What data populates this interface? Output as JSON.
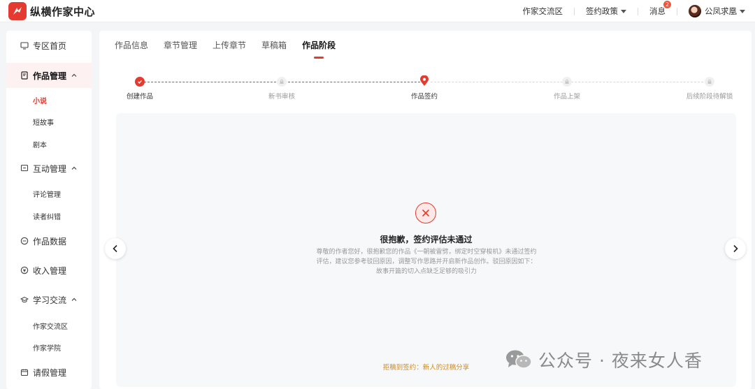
{
  "app": {
    "logo_text": "纵横作家中心",
    "brand_color": "#e53a2f"
  },
  "topnav": {
    "items": [
      {
        "label": "作家交流区"
      },
      {
        "label": "签约政策"
      },
      {
        "label": "消息",
        "badge": "2"
      },
      {
        "label": "公凤求凰"
      }
    ]
  },
  "sidebar": {
    "items": [
      {
        "label": "专区首页",
        "icon": "monitor-icon"
      },
      {
        "label": "作品管理",
        "icon": "book-icon",
        "expanded": true,
        "children": [
          "小说",
          "短故事",
          "剧本"
        ],
        "selected_child": "小说"
      },
      {
        "label": "互动管理",
        "icon": "message-icon",
        "expanded": true,
        "children": [
          "评论管理",
          "读者纠错"
        ]
      },
      {
        "label": "作品数据",
        "icon": "chart-circle-icon"
      },
      {
        "label": "收入管理",
        "icon": "money-icon"
      },
      {
        "label": "学习交流",
        "icon": "graduation-icon",
        "expanded": true,
        "children": [
          "作家交流区",
          "作家学院"
        ]
      },
      {
        "label": "请假管理",
        "icon": "calendar-icon"
      }
    ]
  },
  "tabs": {
    "items": [
      "作品信息",
      "章节管理",
      "上传章节",
      "草稿箱",
      "作品阶段"
    ],
    "active": "作品阶段"
  },
  "steps": {
    "items": [
      {
        "label": "创建作品",
        "state": "done"
      },
      {
        "label": "新书审核",
        "state": "locked"
      },
      {
        "label": "作品签约",
        "state": "current"
      },
      {
        "label": "作品上架",
        "state": "locked"
      },
      {
        "label": "后续阶段待解锁",
        "state": "locked"
      }
    ]
  },
  "result": {
    "title": "很抱歉，签约评估未通过",
    "description": "尊敬的作者您好，很抱歉您的作品《一朝被雷劈，绑定时空穿梭机》未通过签约评估，建议您参考驳回原因，调整写作思路并开启新作品创作。驳回原因如下：故事开篇的切入点缺乏足够的吸引力",
    "footnote": "拒稿到签约：新人的过稿分享"
  },
  "watermark": {
    "text": "公众号 · 夜来女人香"
  }
}
